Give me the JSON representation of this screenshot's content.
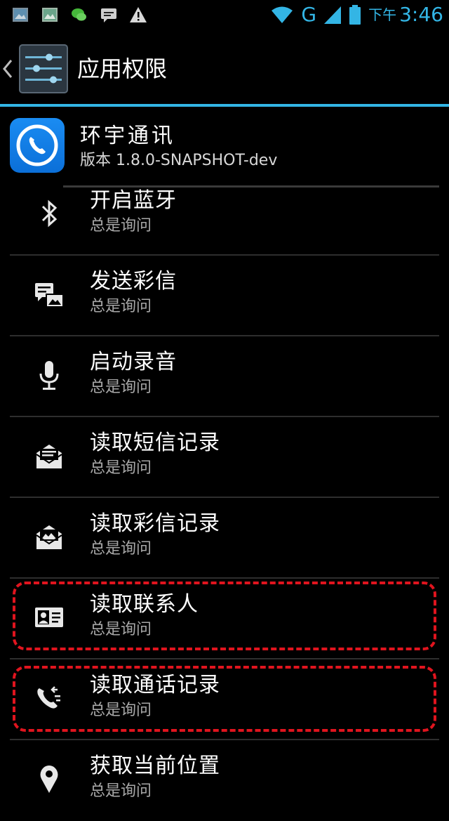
{
  "status_bar": {
    "network_type": "G",
    "ampm": "下午",
    "time": "3:46",
    "notification_icons": [
      "photo-icon",
      "gallery-icon",
      "wechat-icon",
      "message-icon",
      "warning-icon"
    ],
    "accent_color": "#33b5e5"
  },
  "action_bar": {
    "title": "应用权限",
    "icon": "settings-sliders-icon",
    "accent_color": "#33b5e5"
  },
  "app": {
    "name": "环宇通讯",
    "version": "版本 1.8.0-SNAPSHOT-dev",
    "icon": "phone-call-icon"
  },
  "permissions": [
    {
      "title": "开启蓝牙",
      "status": "总是询问",
      "icon": "bluetooth-icon",
      "highlighted": false
    },
    {
      "title": "发送彩信",
      "status": "总是询问",
      "icon": "mms-icon",
      "highlighted": false
    },
    {
      "title": "启动录音",
      "status": "总是询问",
      "icon": "microphone-icon",
      "highlighted": false
    },
    {
      "title": "读取短信记录",
      "status": "总是询问",
      "icon": "sms-read-icon",
      "highlighted": false
    },
    {
      "title": "读取彩信记录",
      "status": "总是询问",
      "icon": "mms-read-icon",
      "highlighted": false
    },
    {
      "title": "读取联系人",
      "status": "总是询问",
      "icon": "contact-card-icon",
      "highlighted": true
    },
    {
      "title": "读取通话记录",
      "status": "总是询问",
      "icon": "call-log-icon",
      "highlighted": true
    },
    {
      "title": "获取当前位置",
      "status": "总是询问",
      "icon": "location-pin-icon",
      "highlighted": false
    }
  ],
  "highlight_color": "#e0141e"
}
